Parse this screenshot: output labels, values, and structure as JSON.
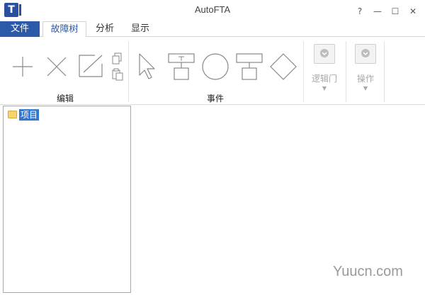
{
  "window": {
    "title": "AutoFTA",
    "app_icon_letter": "T",
    "controls": {
      "help": "?",
      "minimize": "—",
      "maximize": "☐",
      "close": "✕"
    }
  },
  "tabs": {
    "file": "文件",
    "items": [
      {
        "label": "故障树",
        "active": true
      },
      {
        "label": "分析",
        "active": false
      },
      {
        "label": "显示",
        "active": false
      }
    ]
  },
  "ribbon": {
    "groups": {
      "edit": {
        "label": "编辑"
      },
      "event": {
        "label": "事件"
      }
    },
    "disabled_buttons": [
      {
        "label": "逻辑门"
      },
      {
        "label": "操作"
      }
    ]
  },
  "tree": {
    "items": [
      {
        "label": "项目",
        "selected": true
      }
    ]
  },
  "watermark": "Yuucn.com",
  "colors": {
    "accent": "#2d5aa8",
    "selection": "#3377d0",
    "folder": "#f7d36b"
  }
}
